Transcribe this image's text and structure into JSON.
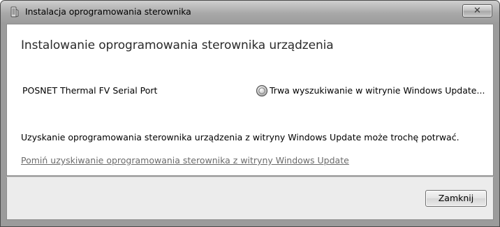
{
  "window": {
    "title": "Instalacja oprogramowania sterownika",
    "close_label": "✕",
    "icon": "driver-installer-icon"
  },
  "main": {
    "heading": "Instalowanie oprogramowania sterownika urządzenia",
    "device_name": "POSNET Thermal FV Serial Port",
    "status_icon": "searching-spinner-icon",
    "status_text": "Trwa wyszukiwanie w witrynie Windows Update...",
    "info_text": "Uzyskanie oprogramowania sterownika urządzenia z witryny Windows Update może trochę potrwać.",
    "skip_link": "Pomiń uzyskiwanie oprogramowania sterownika z witryny Windows Update"
  },
  "footer": {
    "close_button_label": "Zamknij"
  },
  "colors": {
    "titlebar": "#a9a9a9",
    "link": "#6b6b6b",
    "footer_bg": "#ececec"
  }
}
